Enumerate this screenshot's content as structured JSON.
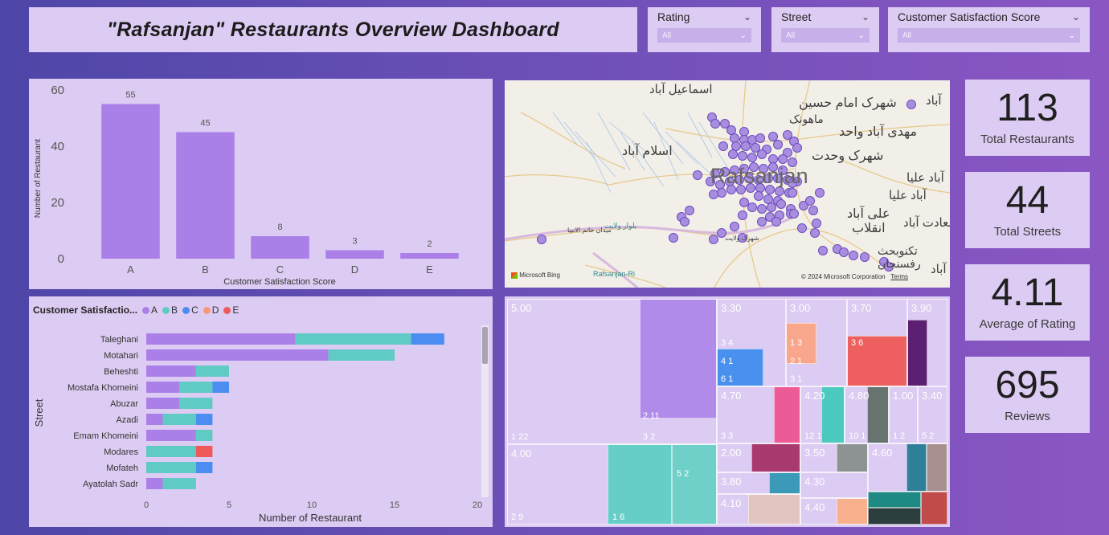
{
  "title": "\"Rafsanjan\" Restaurants Overview Dashboard",
  "slicers": [
    {
      "label": "Rating",
      "value": "All"
    },
    {
      "label": "Street",
      "value": "All"
    },
    {
      "label": "Customer Satisfaction Score",
      "value": "All"
    }
  ],
  "kpis": [
    {
      "value": "113",
      "caption": "Total Restaurants"
    },
    {
      "value": "44",
      "caption": "Total Streets"
    },
    {
      "value": "4.11",
      "caption": "Average of Rating"
    },
    {
      "value": "695",
      "caption": "Reviews"
    }
  ],
  "bar_chart": {
    "type": "bar",
    "categories": [
      "A",
      "B",
      "C",
      "D",
      "E"
    ],
    "values": [
      55,
      45,
      8,
      3,
      2
    ],
    "xlabel": "Customer Satisfaction Score",
    "ylabel": "Number of Restaurant",
    "yticks": [
      "0",
      "20",
      "40",
      "60"
    ],
    "ylim": [
      0,
      60
    ],
    "color": "#aa7fe8"
  },
  "stacked_chart": {
    "type": "bar",
    "orientation": "horizontal",
    "legend_title": "Customer Satisfactio...",
    "legend": [
      "A",
      "B",
      "C",
      "D",
      "E"
    ],
    "colors": [
      "#aa7fe8",
      "#5fcbc4",
      "#4b8df0",
      "#f7977a",
      "#ee5a5a"
    ],
    "categories": [
      "Taleghani",
      "Motahari",
      "Beheshti",
      "Mostafa Khomeini",
      "Abuzar",
      "Azadi",
      "Emam Khomeini",
      "Modares",
      "Mofateh",
      "Ayatolah Sadr"
    ],
    "series": [
      {
        "name": "A",
        "values": [
          9,
          11,
          3,
          2,
          2,
          1,
          3,
          0,
          0,
          1
        ]
      },
      {
        "name": "B",
        "values": [
          7,
          4,
          2,
          2,
          2,
          2,
          1,
          3,
          3,
          2
        ]
      },
      {
        "name": "C",
        "values": [
          2,
          0,
          0,
          1,
          0,
          1,
          0,
          0,
          1,
          0
        ]
      },
      {
        "name": "D",
        "values": [
          0,
          0,
          0,
          0,
          0,
          0,
          0,
          0,
          0,
          0
        ]
      },
      {
        "name": "E",
        "values": [
          0,
          0,
          0,
          0,
          0,
          0,
          0,
          1,
          0,
          0
        ]
      }
    ],
    "xticks": [
      "0",
      "5",
      "10",
      "15",
      "20"
    ],
    "xlim": [
      0,
      20
    ],
    "xlabel": "Number of Restaurant",
    "ylabel": "Street"
  },
  "map": {
    "labels": [
      "اسماعیل آباد",
      "شهرک امام حسین",
      "ماهونک",
      "مهدی آباد واحد",
      "اسلام آباد",
      "شهرک وحدت",
      "Rafsanjan",
      "آباد علیا",
      "آباد علیا",
      "علی آباد",
      "انقلاب",
      "سعادت آباد",
      "تکنوبحث",
      "رفسنجان",
      "آباد",
      "آباد",
      "بلوار ولایت",
      "میدان خاتم الانبیا",
      "شهرک ولایت",
      "Rafsanjan-Ri"
    ],
    "attribution": "© 2024 Microsoft Corporation",
    "terms": "Terms",
    "brand": "Microsoft Bing"
  },
  "treemap": [
    {
      "value": "5.00",
      "sub": [
        "1 22",
        "2 11",
        "3 2"
      ],
      "color": "#aa7fe8"
    },
    {
      "value": "3.30",
      "sub": [
        "3 4",
        "4 1",
        "6 1"
      ],
      "color": "#3f8ef2"
    },
    {
      "value": "3.00",
      "sub": [
        "1 3",
        "2 1",
        "3 1"
      ],
      "color": "#f7977a"
    },
    {
      "value": "3.70",
      "sub": [
        "3 6"
      ],
      "color": "#ea5555"
    },
    {
      "value": "3.90",
      "sub": [],
      "color": "#5a1d6e"
    },
    {
      "value": "4.70",
      "sub": [
        "3 3"
      ],
      "color": "#e6508f"
    },
    {
      "value": "4.20",
      "sub": [
        "12 1"
      ],
      "color": "#40c2b8"
    },
    {
      "value": "4.80",
      "sub": [
        "10 1"
      ],
      "color": "#5c6a6a"
    },
    {
      "value": "1.00",
      "sub": [
        "1 2"
      ],
      "color": "#f67a7a"
    },
    {
      "value": "3.40",
      "sub": [
        "5 2"
      ],
      "color": "#f2cc55"
    },
    {
      "value": "2.00",
      "sub": [],
      "color": "#a3336a"
    },
    {
      "value": "4.00",
      "sub": [
        "2 9",
        "1 6",
        "5 2"
      ],
      "color": "#5fcbc4"
    },
    {
      "value": "3.80",
      "sub": [],
      "color": "#2b95b6"
    },
    {
      "value": "3.50",
      "sub": [],
      "color": "#828a8a"
    },
    {
      "value": "4.60",
      "sub": [],
      "color": "#b388b8"
    },
    {
      "value": "4.30",
      "sub": [],
      "color": "#a1dcef"
    },
    {
      "value": "4.10",
      "sub": [],
      "color": "#dcb8b4"
    },
    {
      "value": "4.40",
      "sub": [],
      "color": "#f9a67a"
    }
  ]
}
